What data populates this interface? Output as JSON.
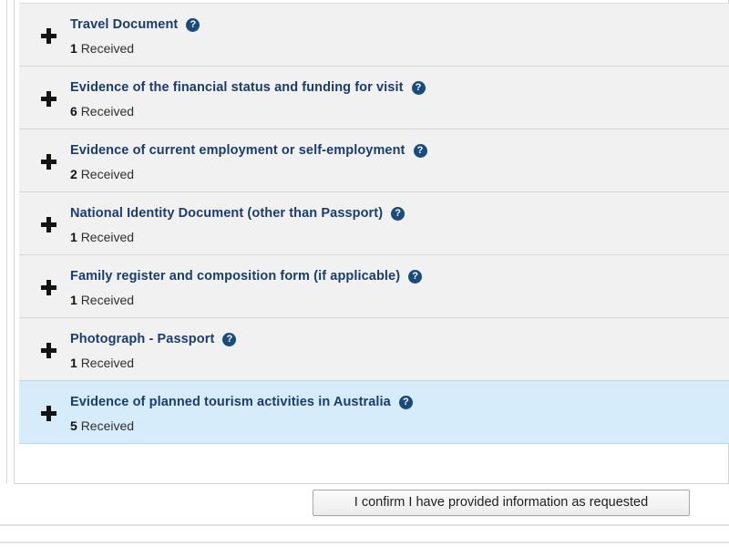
{
  "panel": {
    "name": "document-checklist-accordion",
    "help_icon_glyph": "?",
    "help_icon_name": "help-icon",
    "expand_icon_name": "plus-icon",
    "count_word": "Received",
    "rows": [
      {
        "title": "Travel Document",
        "count": "1",
        "selected": false
      },
      {
        "title": "Evidence of the financial status and funding for visit",
        "count": "6",
        "selected": false
      },
      {
        "title": "Evidence of current employment or self-employment",
        "count": "2",
        "selected": false
      },
      {
        "title": "National Identity Document (other than Passport)",
        "count": "1",
        "selected": false
      },
      {
        "title": "Family register and composition form (if applicable)",
        "count": "1",
        "selected": false
      },
      {
        "title": "Photograph - Passport",
        "count": "1",
        "selected": false
      },
      {
        "title": "Evidence of planned tourism activities in Australia",
        "count": "5",
        "selected": true
      }
    ]
  },
  "actions": {
    "confirm_label": "I confirm I have provided information as requested"
  },
  "colors": {
    "title_blue": "#1b3c6e",
    "row_background": "#f1f1f1",
    "row_selected_background": "#d6ecfb",
    "help_icon_background": "#1a4b7e",
    "border": "#d3d3d3"
  }
}
